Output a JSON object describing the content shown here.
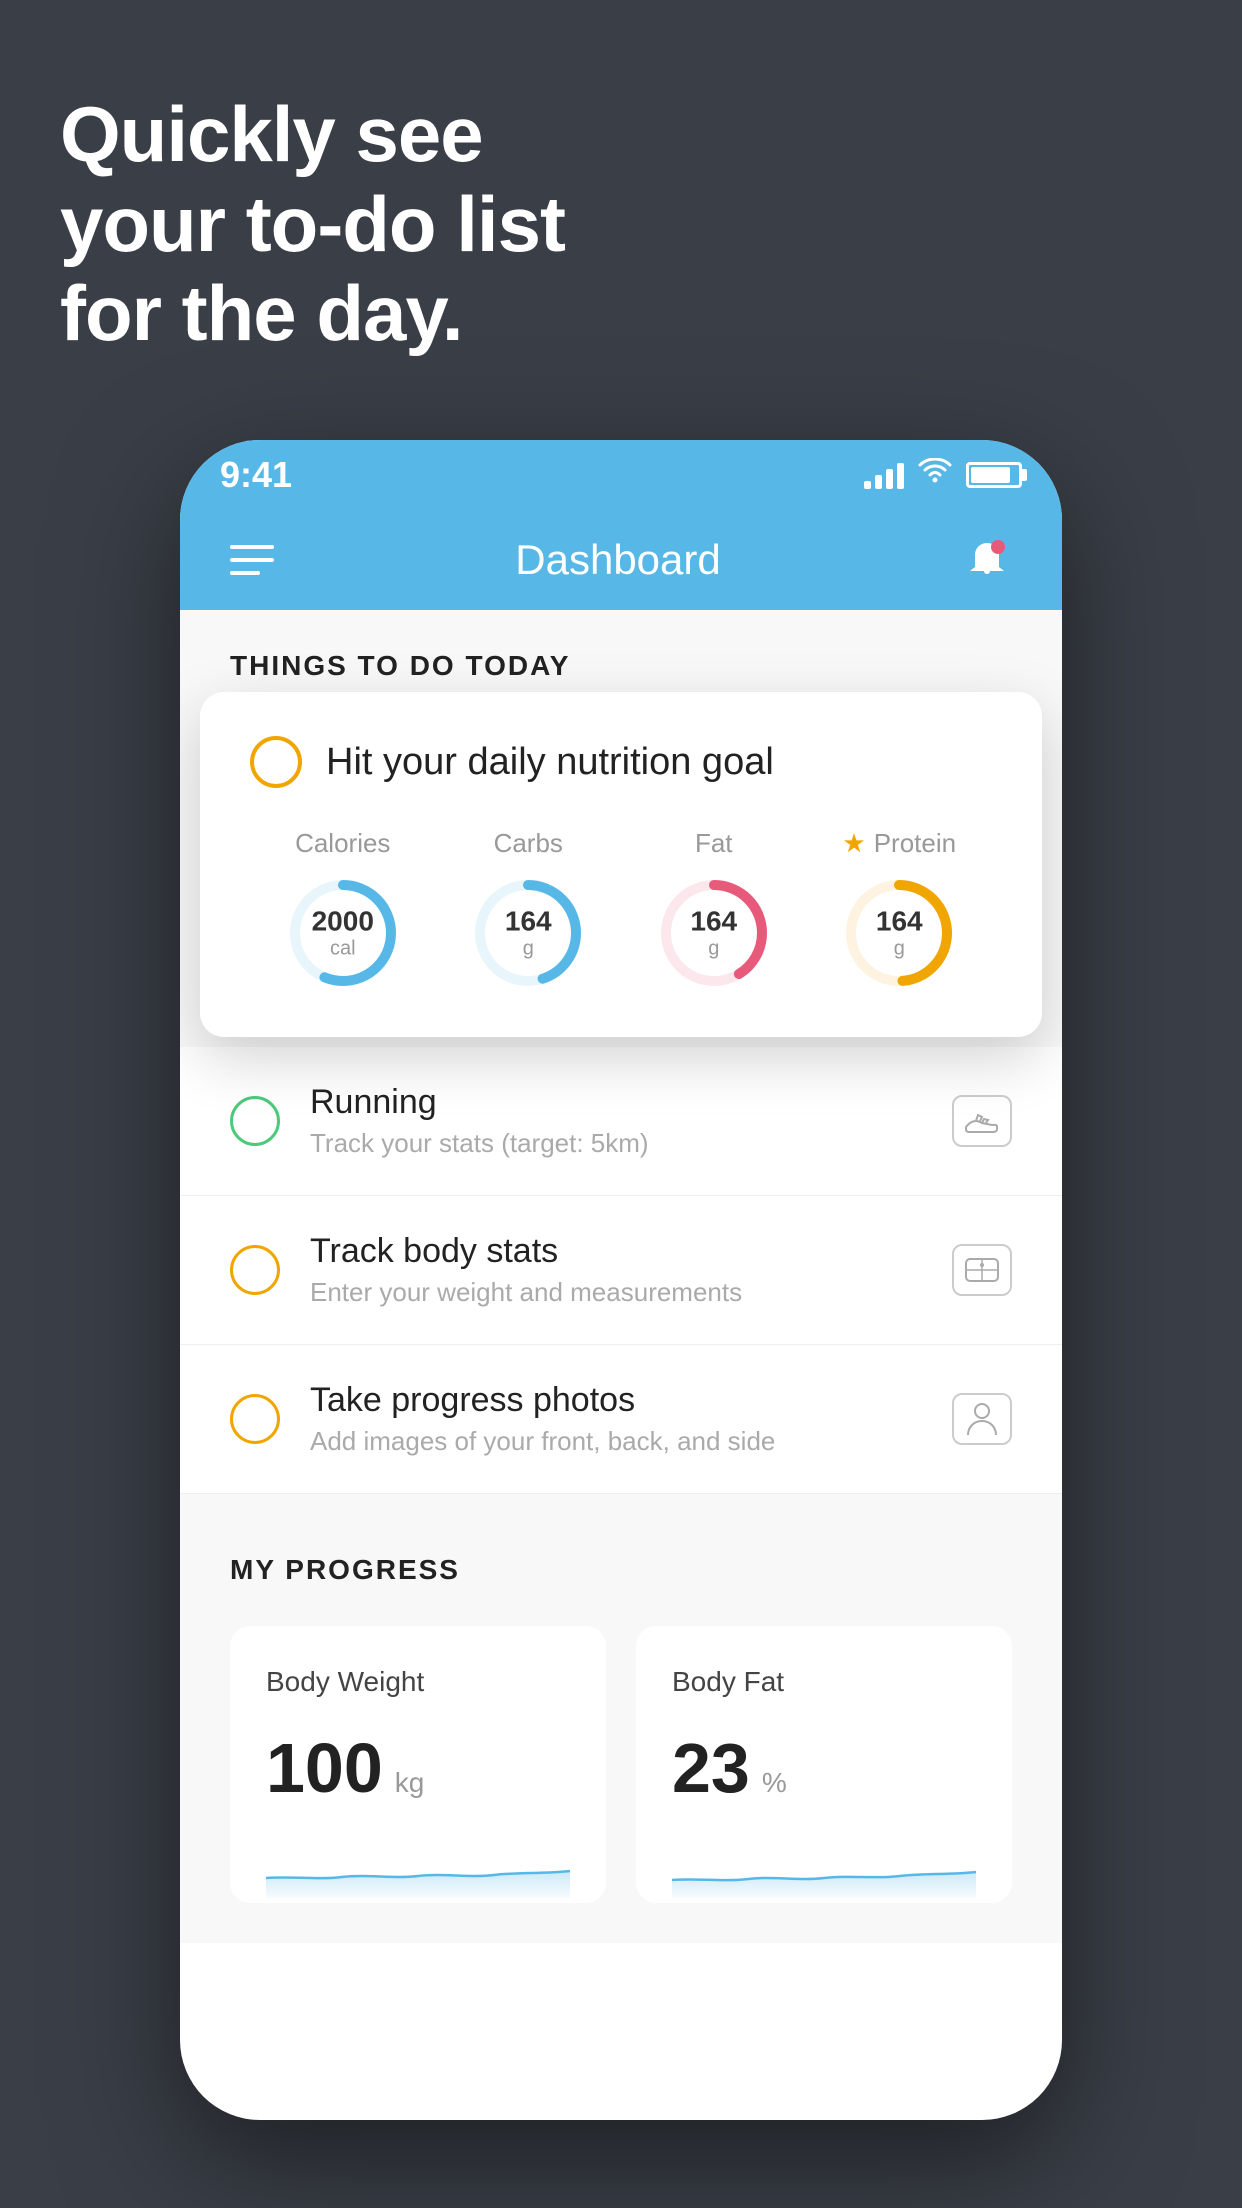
{
  "hero": {
    "line1": "Quickly see",
    "line2": "your to-do list",
    "line3": "for the day."
  },
  "status_bar": {
    "time": "9:41"
  },
  "nav": {
    "title": "Dashboard"
  },
  "things_section": {
    "title": "THINGS TO DO TODAY"
  },
  "nutrition_card": {
    "title": "Hit your daily nutrition goal",
    "stats": [
      {
        "label": "Calories",
        "value": "2000",
        "unit": "cal",
        "color": "#57b8e8",
        "track": 75
      },
      {
        "label": "Carbs",
        "value": "164",
        "unit": "g",
        "color": "#57b8e8",
        "track": 60
      },
      {
        "label": "Fat",
        "value": "164",
        "unit": "g",
        "color": "#e85a7a",
        "track": 55
      },
      {
        "label": "Protein",
        "value": "164",
        "unit": "g",
        "color": "#f0a500",
        "track": 65,
        "starred": true
      }
    ]
  },
  "todo_items": [
    {
      "title": "Running",
      "subtitle": "Track your stats (target: 5km)",
      "circle_color": "green",
      "icon": "shoe"
    },
    {
      "title": "Track body stats",
      "subtitle": "Enter your weight and measurements",
      "circle_color": "yellow",
      "icon": "scale"
    },
    {
      "title": "Take progress photos",
      "subtitle": "Add images of your front, back, and side",
      "circle_color": "yellow",
      "icon": "person"
    }
  ],
  "progress": {
    "section_title": "MY PROGRESS",
    "cards": [
      {
        "title": "Body Weight",
        "value": "100",
        "unit": "kg"
      },
      {
        "title": "Body Fat",
        "value": "23",
        "unit": "%"
      }
    ]
  }
}
